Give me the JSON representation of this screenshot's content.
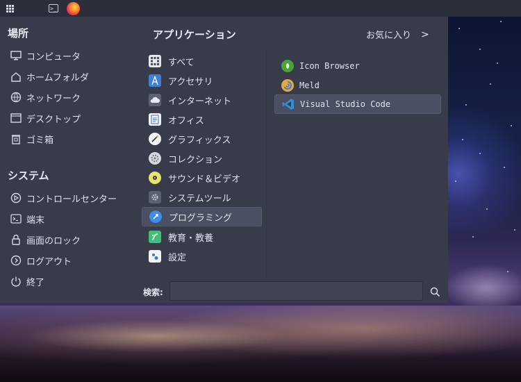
{
  "panel": {
    "apps_icon": "app-grid-icon",
    "terminal_icon": "terminal-icon",
    "browser_icon": "firefox-icon",
    "terminal_glyph": ">_"
  },
  "menu": {
    "places": {
      "title": "場所",
      "items": [
        {
          "label": "コンピュータ",
          "icon": "computer-icon"
        },
        {
          "label": "ホームフォルダ",
          "icon": "home-icon"
        },
        {
          "label": "ネットワーク",
          "icon": "network-icon"
        },
        {
          "label": "デスクトップ",
          "icon": "desktop-icon"
        },
        {
          "label": "ゴミ箱",
          "icon": "trash-icon"
        }
      ]
    },
    "system": {
      "title": "システム",
      "items": [
        {
          "label": "コントロールセンター",
          "icon": "control-center-icon"
        },
        {
          "label": "端末",
          "icon": "terminal-icon"
        },
        {
          "label": "画面のロック",
          "icon": "lock-icon"
        },
        {
          "label": "ログアウト",
          "icon": "logout-icon"
        },
        {
          "label": "終了",
          "icon": "power-icon"
        }
      ]
    },
    "applications": {
      "title": "アプリケーション",
      "categories": [
        {
          "label": "すべて",
          "icon": "all-apps-icon"
        },
        {
          "label": "アクセサリ",
          "icon": "accessories-icon"
        },
        {
          "label": "インターネット",
          "icon": "internet-icon"
        },
        {
          "label": "オフィス",
          "icon": "office-icon"
        },
        {
          "label": "グラフィックス",
          "icon": "graphics-icon"
        },
        {
          "label": "コレクション",
          "icon": "collection-icon"
        },
        {
          "label": "サウンド＆ビデオ",
          "icon": "sound-video-icon"
        },
        {
          "label": "システムツール",
          "icon": "system-tools-icon"
        },
        {
          "label": "プログラミング",
          "icon": "programming-icon"
        },
        {
          "label": "教育・教養",
          "icon": "education-icon"
        },
        {
          "label": "設定",
          "icon": "settings-icon"
        }
      ],
      "selected_category": "プログラミング"
    },
    "favorites": {
      "label": "お気に入り",
      "chevron": ">"
    },
    "apps": [
      {
        "label": "Icon Browser",
        "icon": "icon-browser-icon"
      },
      {
        "label": "Meld",
        "icon": "meld-icon"
      },
      {
        "label": "Visual Studio Code",
        "icon": "vscode-icon"
      }
    ],
    "selected_app": "Visual Studio Code",
    "search": {
      "label": "検索:",
      "value": "",
      "placeholder": ""
    }
  },
  "colors": {
    "panel_bg": "#2c2f3a",
    "menu_bg": "#383c4a",
    "selected_bg": "#4a4f61",
    "text": "#e0e3ea"
  }
}
